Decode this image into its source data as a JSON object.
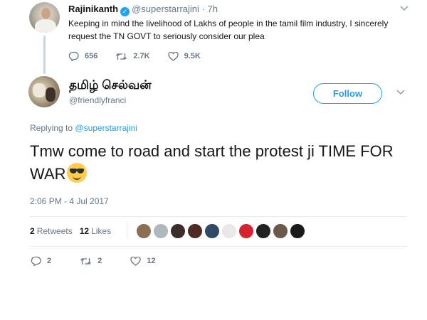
{
  "parent_tweet": {
    "display_name": "Rajinikanth",
    "handle": "@superstarrajini",
    "time": "· 7h",
    "text": "Keeping in mind the livelihood of Lakhs of people in the tamil film industry, I sincerely request the TN GOVT to seriously consider our plea",
    "replies": "656",
    "retweets": "2.7K",
    "likes": "9.5K"
  },
  "main_tweet": {
    "display_name": "தமிழ் செல்வன்",
    "handle": "@friendlyfranci",
    "follow_label": "Follow",
    "replying_prefix": "Replying to",
    "replying_to": "@superstarrajini",
    "text": "Tmw come to road and start the protest ji TIME FOR WAR",
    "emoji": "smiling-face-with-sunglasses",
    "timestamp": "2:06 PM - 4 Jul 2017",
    "retweets_count": "2",
    "retweets_label": "Retweets",
    "likes_count": "12",
    "likes_label": "Likes",
    "reply_count": "2",
    "retweet_count": "2",
    "like_count": "12"
  },
  "colors": {
    "accent": "#1da1f2",
    "muted": "#657786",
    "text": "#14171a",
    "divider": "#e6ecf0"
  },
  "likers": [
    {
      "color": "#8a6f55"
    },
    {
      "color": "#b0b7bf"
    },
    {
      "color": "#3b2e2a"
    },
    {
      "color": "#4d2a24"
    },
    {
      "color": "#2f4a66"
    },
    {
      "color": "#e8e8e8"
    },
    {
      "color": "#d6242f"
    },
    {
      "color": "#222222"
    },
    {
      "color": "#6a5a4a"
    },
    {
      "color": "#1a1a1a"
    }
  ]
}
